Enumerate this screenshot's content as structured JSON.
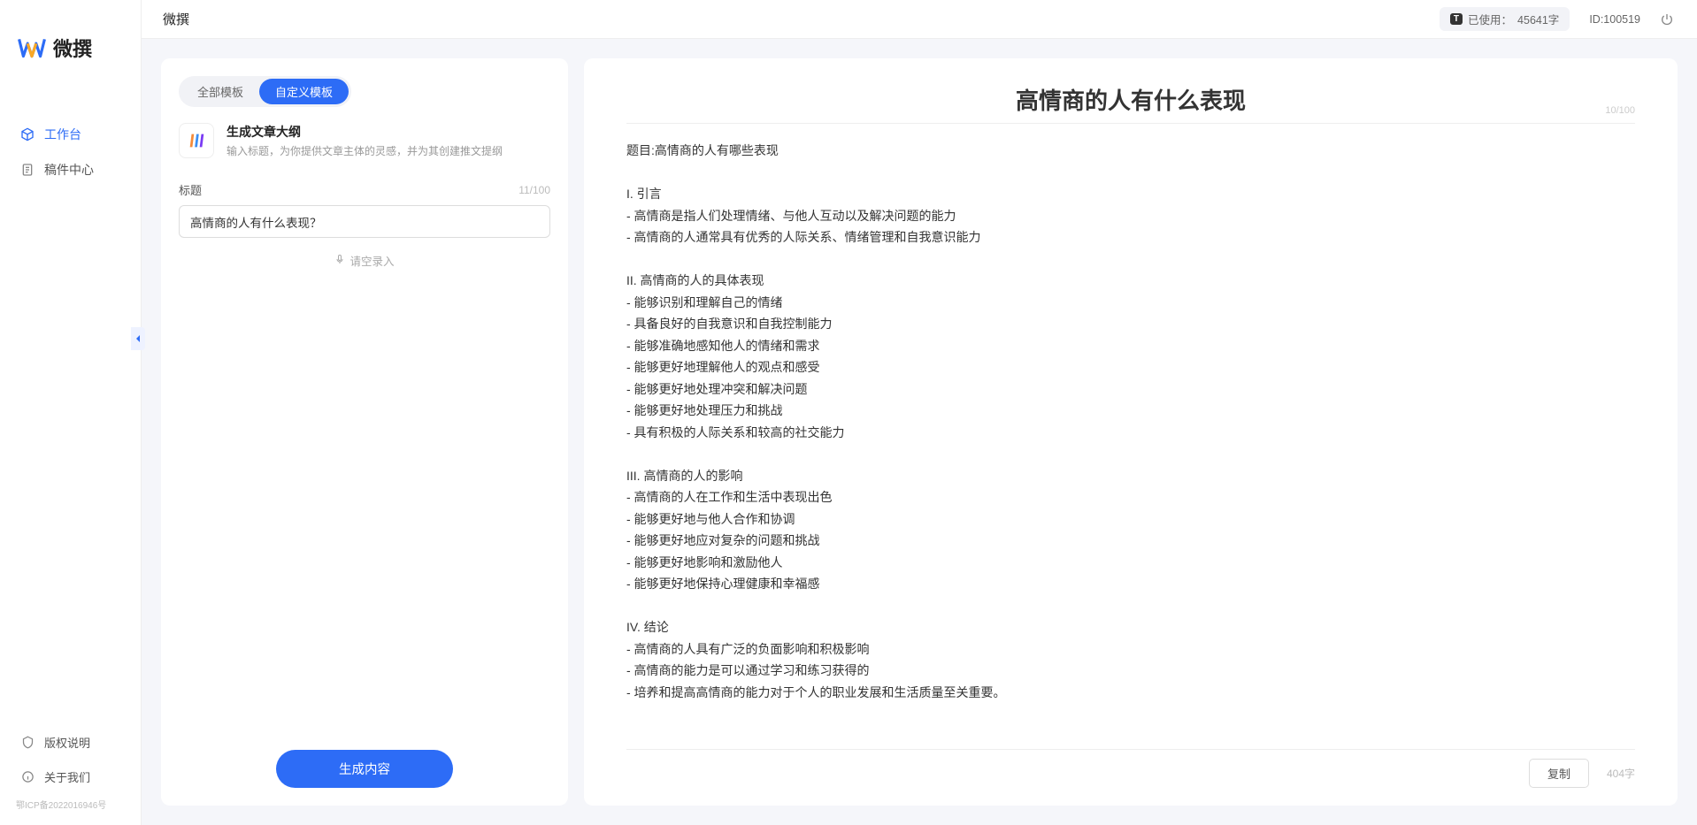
{
  "app_name": "微撰",
  "topbar": {
    "title": "微撰",
    "usage_label": "已使用：",
    "usage_value": "45641字",
    "usage_badge": "T",
    "id_label": "ID:100519"
  },
  "sidebar": {
    "items": [
      {
        "label": "工作台",
        "icon": "cube",
        "active": true
      },
      {
        "label": "稿件中心",
        "icon": "doc",
        "active": false
      }
    ],
    "bottom": [
      {
        "label": "版权说明",
        "icon": "shield"
      },
      {
        "label": "关于我们",
        "icon": "info"
      }
    ],
    "icp": "鄂ICP备2022016946号"
  },
  "left_panel": {
    "tabs": [
      {
        "label": "全部模板",
        "active": false
      },
      {
        "label": "自定义模板",
        "active": true
      }
    ],
    "template": {
      "title": "生成文章大纲",
      "desc": "输入标题，为你提供文章主体的灵感，并为其创建推文提纲"
    },
    "title_label": "标题",
    "title_count": "11/100",
    "title_value": "高情商的人有什么表现？",
    "voice_hint": "请空录入",
    "voice_icon": "mic",
    "generate_btn": "生成内容"
  },
  "right_panel": {
    "heading": "高情商的人有什么表现",
    "top_count": "10/100",
    "body": "题目:高情商的人有哪些表现\n\nI. 引言\n- 高情商是指人们处理情绪、与他人互动以及解决问题的能力\n- 高情商的人通常具有优秀的人际关系、情绪管理和自我意识能力\n\nII. 高情商的人的具体表现\n- 能够识别和理解自己的情绪\n- 具备良好的自我意识和自我控制能力\n- 能够准确地感知他人的情绪和需求\n- 能够更好地理解他人的观点和感受\n- 能够更好地处理冲突和解决问题\n- 能够更好地处理压力和挑战\n- 具有积极的人际关系和较高的社交能力\n\nIII. 高情商的人的影响\n- 高情商的人在工作和生活中表现出色\n- 能够更好地与他人合作和协调\n- 能够更好地应对复杂的问题和挑战\n- 能够更好地影响和激励他人\n- 能够更好地保持心理健康和幸福感\n\nIV. 结论\n- 高情商的人具有广泛的负面影响和积极影响\n- 高情商的能力是可以通过学习和练习获得的\n- 培养和提高高情商的能力对于个人的职业发展和生活质量至关重要。",
    "copy_btn": "复制",
    "word_count": "404字"
  }
}
